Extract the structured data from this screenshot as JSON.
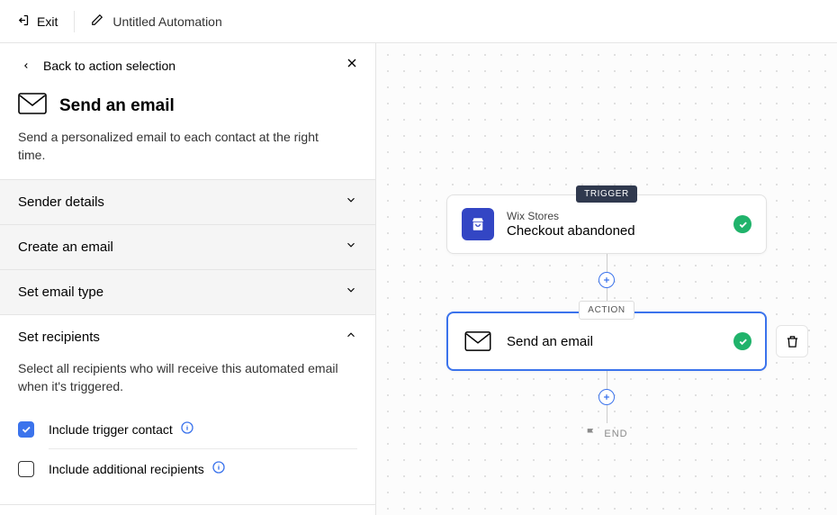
{
  "topbar": {
    "exit_label": "Exit",
    "title": "Untitled Automation"
  },
  "sidebar": {
    "back_label": "Back to action selection",
    "panel_title": "Send an email",
    "panel_desc": "Send a personalized email to each contact at the right time.",
    "sections": [
      {
        "title": "Sender details"
      },
      {
        "title": "Create an email"
      },
      {
        "title": "Set email type"
      },
      {
        "title": "Set recipients",
        "body_desc": "Select all recipients who will receive this automated email when it's triggered.",
        "options": [
          {
            "label": "Include trigger contact",
            "checked": true
          },
          {
            "label": "Include additional recipients",
            "checked": false
          }
        ]
      }
    ]
  },
  "canvas": {
    "trigger_tag": "TRIGGER",
    "action_tag": "ACTION",
    "end_label": "END",
    "trigger": {
      "subtitle": "Wix Stores",
      "title": "Checkout abandoned"
    },
    "action": {
      "title": "Send an email"
    }
  }
}
